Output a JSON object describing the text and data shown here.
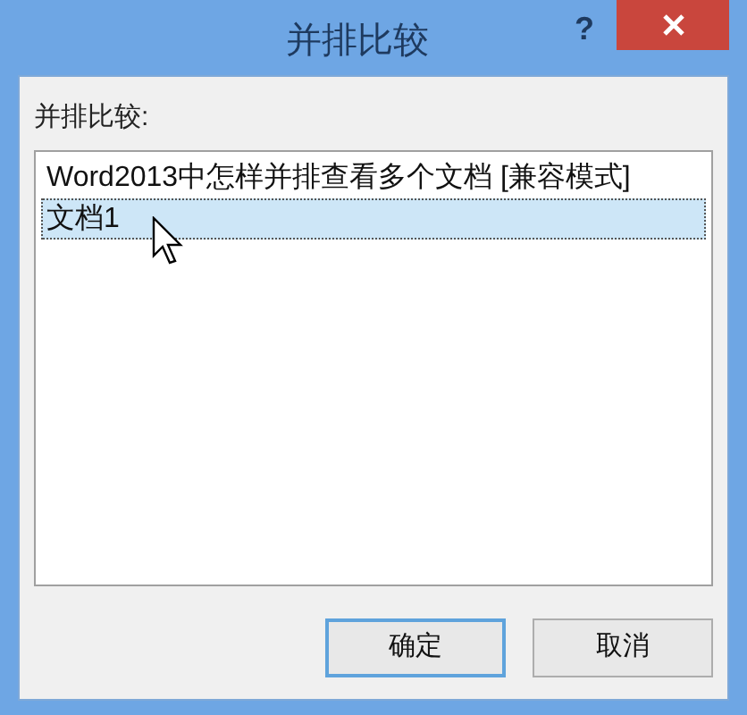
{
  "window": {
    "title": "并排比较",
    "help": "?"
  },
  "list": {
    "label": "并排比较:",
    "items": [
      {
        "text": "Word2013中怎样并排查看多个文档 [兼容模式]",
        "selected": false
      },
      {
        "text": "文档1",
        "selected": true
      }
    ]
  },
  "buttons": [
    {
      "label": "确定",
      "default": true
    },
    {
      "label": "取消",
      "default": false
    }
  ]
}
